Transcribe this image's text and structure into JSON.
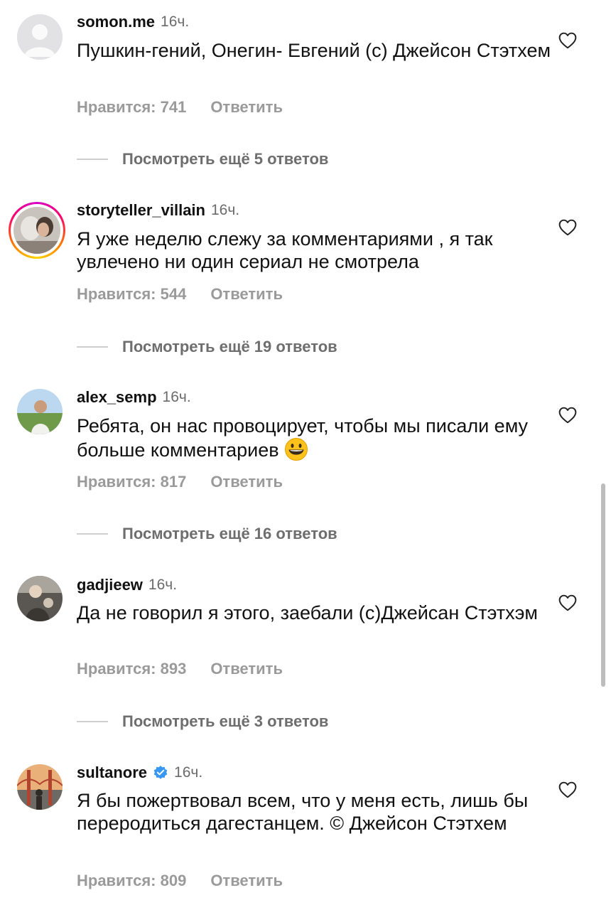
{
  "comments": [
    {
      "username": "somon.me",
      "time": "16ч.",
      "text": "Пушкин-гений, Онегин- Евгений (с) Джейсон Стэтхем",
      "likes": "Нравится: 741",
      "reply": "Ответить",
      "more": "Посмотреть ещё 5 ответов",
      "avatar": "default-avatar"
    },
    {
      "username": "storyteller_villain",
      "time": "16ч.",
      "text": "Я уже неделю слежу за комментариями , я так увлечено ни один сериал не смотрела",
      "likes": "Нравится: 544",
      "reply": "Ответить",
      "more": "Посмотреть ещё 19 ответов",
      "avatar": "story-ring-avatar"
    },
    {
      "username": "alex_semp",
      "time": "16ч.",
      "text": "Ребята, он нас провоцирует, чтобы мы писали ему больше комментариев",
      "emoji": "grinning-face-emoji",
      "likes": "Нравится: 817",
      "reply": "Ответить",
      "more": "Посмотреть ещё 16 ответов",
      "avatar": "photo-avatar"
    },
    {
      "username": "gadjieew",
      "time": "16ч.",
      "text": "Да не говорил я этого, заебали (с)Джейсан Стэтхэм",
      "likes": "Нравится: 893",
      "reply": "Ответить",
      "more": "Посмотреть ещё 3 ответов",
      "avatar": "photo-avatar"
    },
    {
      "username": "sultanore",
      "time": "16ч.",
      "verified": true,
      "text": "Я бы пожертвовал всем, что у меня есть, лишь бы переродиться дагестанцем. © Джейсон Стэтхем",
      "likes": "Нравится: 809",
      "reply": "Ответить",
      "avatar": "bridge-photo-avatar"
    }
  ],
  "colors": {
    "text": "#111111",
    "secondary": "#9a9a9a",
    "verified": "#3897f0"
  },
  "icons": {
    "like": "heart-outline-icon",
    "verified": "verified-badge-icon"
  }
}
